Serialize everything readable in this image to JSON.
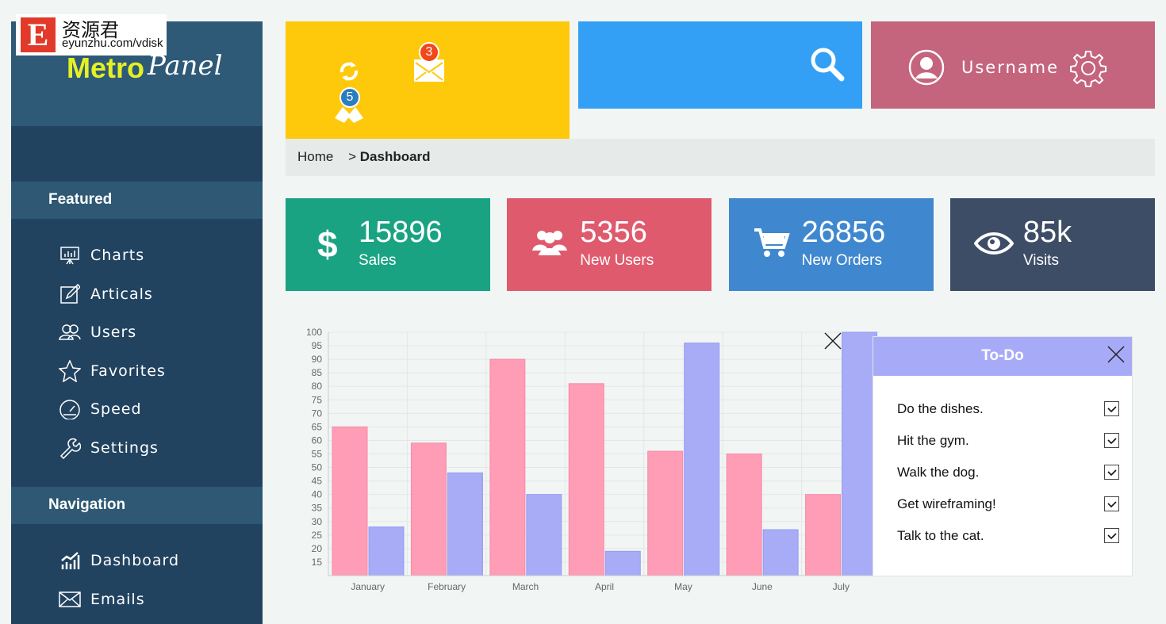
{
  "watermark": {
    "letter": "E",
    "name": "资源君",
    "url": "eyunzhu.com/vdisk"
  },
  "logo": {
    "word1": "Metro",
    "word2": "Panel"
  },
  "sidebar": {
    "featured_label": "Featured",
    "featured": [
      {
        "label": "Charts",
        "icon": "presentation-chart-icon"
      },
      {
        "label": "Articals",
        "icon": "edit-icon"
      },
      {
        "label": "Users",
        "icon": "users-icon"
      },
      {
        "label": "Favorites",
        "icon": "star-icon"
      },
      {
        "label": "Speed",
        "icon": "speedometer-icon"
      },
      {
        "label": "Settings",
        "icon": "wrench-icon"
      }
    ],
    "navigation_label": "Navigation",
    "navigation": [
      {
        "label": "Dashboard",
        "icon": "bar-chart-icon"
      },
      {
        "label": "Emails",
        "icon": "envelope-icon"
      }
    ]
  },
  "header": {
    "mail_count": "3",
    "bell_count": "5",
    "username": "Username"
  },
  "breadcrumb": {
    "home": "Home",
    "sep": ">",
    "current": "Dashboard"
  },
  "stats": [
    {
      "value": "15896",
      "label": "Sales",
      "icon": "dollar-icon",
      "color": "#1aa383"
    },
    {
      "value": "5356",
      "label": "New Users",
      "icon": "users-icon",
      "color": "#e05a6e"
    },
    {
      "value": "26856",
      "label": "New Orders",
      "icon": "cart-icon",
      "color": "#3f88cf"
    },
    {
      "value": "85k",
      "label": "Visits",
      "icon": "eye-icon",
      "color": "#3d4d66"
    }
  ],
  "chart_data": {
    "type": "bar",
    "categories": [
      "January",
      "February",
      "March",
      "April",
      "May",
      "June",
      "July"
    ],
    "series": [
      {
        "values": [
          65,
          59,
          90,
          81,
          56,
          55,
          40
        ],
        "color": "#ff9db6"
      },
      {
        "values": [
          28,
          48,
          40,
          19,
          96,
          27,
          100
        ],
        "color": "#a8acf7"
      }
    ],
    "ylim": [
      10,
      100
    ],
    "yticks": [
      15,
      20,
      25,
      30,
      35,
      40,
      45,
      50,
      55,
      60,
      65,
      70,
      75,
      80,
      85,
      90,
      95,
      100
    ],
    "grid": true
  },
  "todo": {
    "title": "To-Do",
    "items": [
      "Do the dishes.",
      "Hit the gym.",
      "Walk the dog.",
      "Get wireframing!",
      "Talk to the cat."
    ]
  }
}
